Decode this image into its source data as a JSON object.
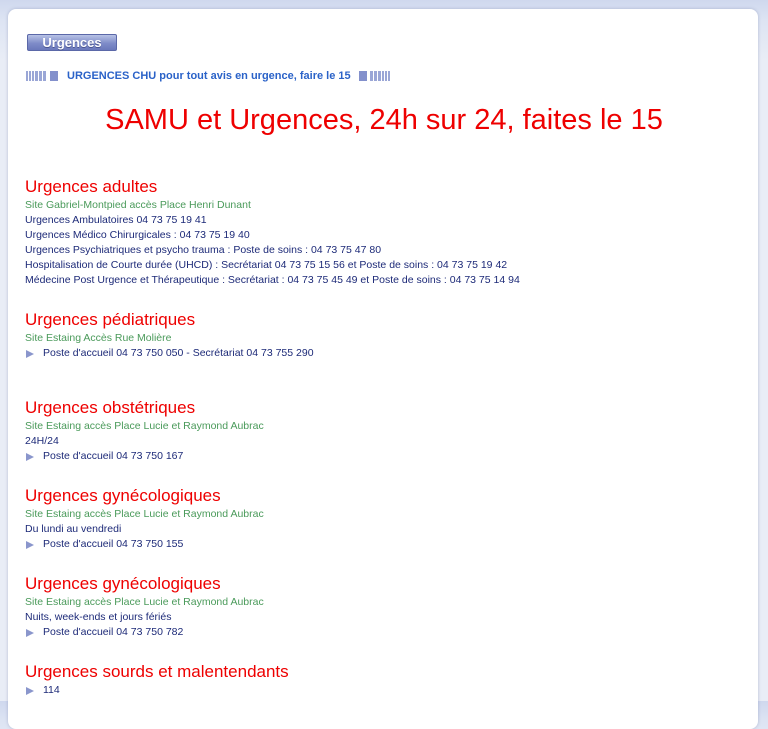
{
  "tab_label": "Urgences",
  "banner_text": "URGENCES CHU pour tout avis en urgence, faire le 15",
  "headline": "SAMU et Urgences, 24h sur 24, faites le 15",
  "sections": [
    {
      "title": "Urgences adultes",
      "site": "Site Gabriel-Montpied accès Place Henri Dunant",
      "lines": [
        "Urgences Ambulatoires 04 73 75 19 41",
        "Urgences Médico Chirurgicales : 04 73 75 19 40",
        "Urgences Psychiatriques et psycho trauma : Poste de soins : 04 73 75 47 80",
        "Hospitalisation de Courte durée (UHCD) : Secrétariat 04 73 75 15 56 et Poste de soins : 04 73 75 19 42",
        "Médecine Post Urgence et Thérapeutique : Secrétariat : 04 73 75 45 49 et Poste de soins : 04 73 75 14 94"
      ]
    },
    {
      "title": "Urgences pédiatriques",
      "site": "Site Estaing Accès Rue Molière",
      "bullet": "Poste d'accueil 04 73 750 050 - Secrétariat 04 73 755 290"
    },
    {
      "title": "Urgences obstétriques",
      "site": "Site Estaing accès Place Lucie et Raymond Aubrac",
      "note": "24H/24",
      "bullet": "Poste d'accueil 04 73 750 167"
    },
    {
      "title": "Urgences gynécologiques",
      "site": "Site Estaing accès Place Lucie et Raymond Aubrac",
      "note": "Du lundi au vendredi",
      "bullet": "Poste d'accueil 04 73 750 155"
    },
    {
      "title": "Urgences gynécologiques",
      "site": "Site Estaing accès Place Lucie et Raymond Aubrac",
      "note": "Nuits, week-ends et jours fériés",
      "bullet": "Poste d'accueil 04 73 750 782"
    },
    {
      "title": "Urgences sourds et malentendants",
      "bullet": "114"
    }
  ],
  "colors": {
    "headline": "#ee0000",
    "site": "#4a9a5a",
    "text": "#1d2a78",
    "banner": "#2a62c8"
  }
}
